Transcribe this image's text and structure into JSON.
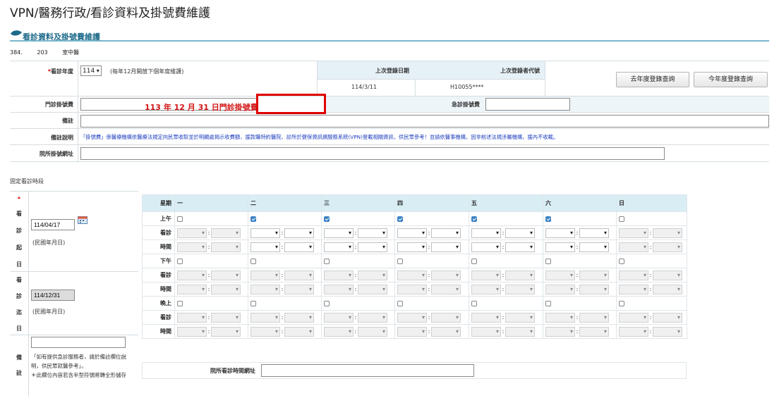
{
  "page": {
    "title": "VPN/醫務行政/看診資料及掛號費維護",
    "section_title": "看診資料及掛號費維護",
    "info": [
      "384.",
      "203",
      "室中醫"
    ]
  },
  "form": {
    "year_label": "看診年度",
    "year_value": "114",
    "year_note": "(每年12月開放下個年度維護)",
    "last_login_date_label": "上次登錄日期",
    "last_login_date_value": "114/3/11",
    "last_login_code_label": "上次登錄者代號",
    "last_login_code_value": "H10055****",
    "btn_last_year": "去年度登錄查詢",
    "btn_this_year": "今年度登錄查詢",
    "outpatient_fee_label": "門診掛號費",
    "outpatient_fee_value": "",
    "annotation": "113 年 12 月 31 日門診掛號費",
    "emergency_fee_label": "急診掛號費",
    "emergency_fee_value": "",
    "remark_label": "備註",
    "remark_value": "",
    "remark_note_label": "備註說明",
    "remark_note_text": "「掛號費」係醫療機構依醫療法規定向民眾收取並於明顯處揭示收費額，援款職特約醫院、診所於健保資訊網服務系統(VPN)登載相關資訊，供民眾參考！並請依醫事機構，因非前述法規涉屬機構，援內不收載。",
    "website_label": "院所掛號網址",
    "website_value": ""
  },
  "schedule": {
    "section_label": "固定看診時段",
    "start_label": [
      "看",
      "診",
      "起",
      "日"
    ],
    "start_date": "114/04/17",
    "start_hint": "(民國年月日)",
    "end_label": [
      "看",
      "診",
      "迄",
      "日"
    ],
    "end_date": "114/12/31",
    "end_hint": "(民國年月日)",
    "note_label": [
      "備",
      "註"
    ],
    "note_value": "",
    "note_hint": "「如有提供急診服務者，請於備註欄位說明，供民眾就醫參考」。\n＊此欄位內容若含半型符號將轉全形儲存",
    "week_label": "星期",
    "days": [
      "一",
      "二",
      "三",
      "四",
      "五",
      "六",
      "日"
    ],
    "sessions": [
      {
        "name": "上午",
        "checked": [
          false,
          true,
          true,
          true,
          true,
          true,
          false
        ]
      },
      {
        "name": "下午",
        "checked": [
          false,
          false,
          false,
          false,
          false,
          false,
          false
        ]
      },
      {
        "name": "晚上",
        "checked": [
          false,
          false,
          false,
          false,
          false,
          false,
          false
        ]
      }
    ],
    "time_label_1": "看診",
    "time_label_2": "時間",
    "website_label": "院所看診時間網址",
    "website_value": ""
  }
}
